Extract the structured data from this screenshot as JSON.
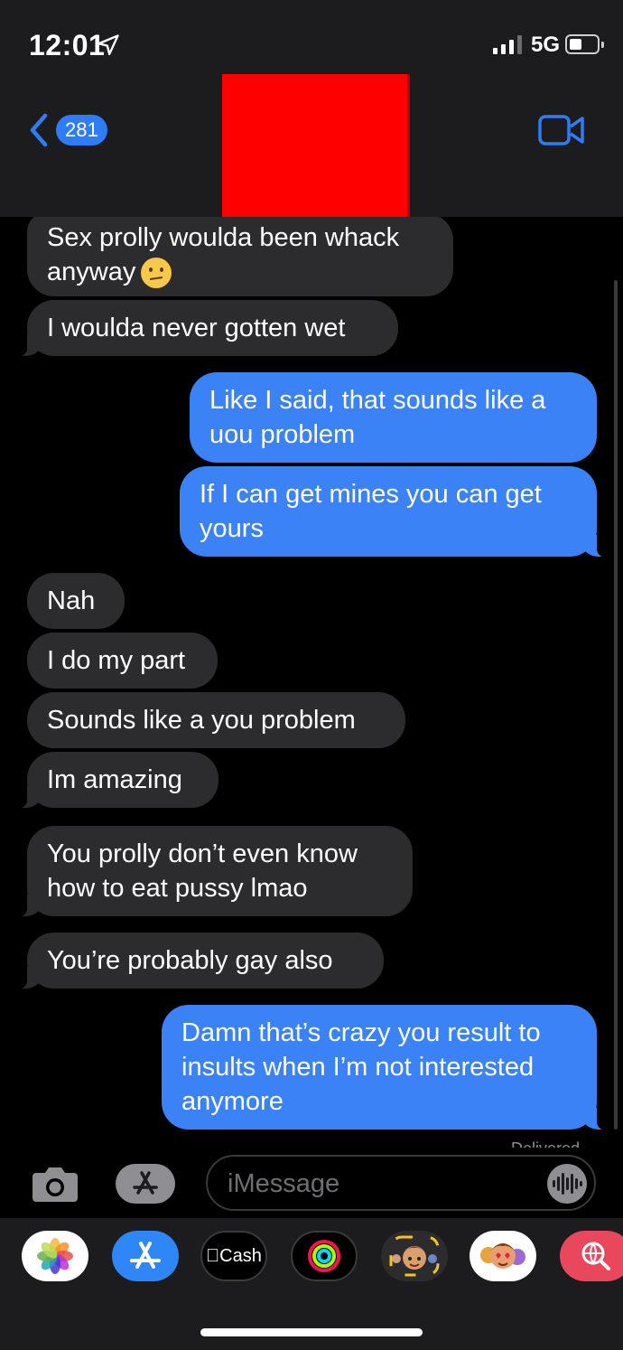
{
  "status": {
    "time": "12:01",
    "network": "5G"
  },
  "header": {
    "back_count": "281"
  },
  "messages": [
    {
      "from": "them",
      "text": "Sex prolly woulda been whack anyway",
      "emoji": "confused-face"
    },
    {
      "from": "them",
      "text": "I woulda never gotten wet"
    },
    {
      "from": "me",
      "text": "Like I said, that sounds like a uou problem"
    },
    {
      "from": "me",
      "text": "If I can get mines you can get yours"
    },
    {
      "from": "them",
      "text": "Nah"
    },
    {
      "from": "them",
      "text": "I do my part"
    },
    {
      "from": "them",
      "text": "Sounds like a you problem"
    },
    {
      "from": "them",
      "text": "Im amazing"
    },
    {
      "from": "them",
      "text": "You prolly don’t even know how to eat pussy lmao"
    },
    {
      "from": "them",
      "text": "You’re probably gay also"
    },
    {
      "from": "me",
      "text": "Damn that’s crazy you result to insults when I’m not interested anymore"
    }
  ],
  "delivered_label": "Delivered",
  "composer": {
    "placeholder": "iMessage"
  },
  "drawer": {
    "apps": [
      {
        "icon": "photos-icon"
      },
      {
        "icon": "app-store-icon"
      },
      {
        "icon": "apple-cash-icon",
        "label": "Cash"
      },
      {
        "icon": "activity-icon"
      },
      {
        "icon": "memoji-icon"
      },
      {
        "icon": "animoji-stickers-icon"
      },
      {
        "icon": "web-search-icon"
      }
    ]
  },
  "colors": {
    "outgoing": "#3b82f6",
    "incoming": "#2c2c2e",
    "accent": "#2f7df6"
  }
}
